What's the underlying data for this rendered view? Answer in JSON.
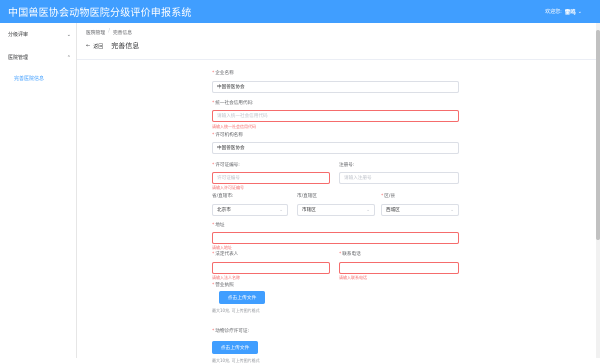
{
  "header": {
    "app_title": "中国兽医协会动物医院分级评价申报系统",
    "welcome_label": "欢迎您:",
    "username": "雷鸣",
    "user_caret": "⌄"
  },
  "sidebar": {
    "menus": [
      {
        "label": "分级评审",
        "chevron": "⌄"
      },
      {
        "label": "医院管理",
        "chevron": "⌃"
      }
    ],
    "sub_item": "完善医院信息"
  },
  "breadcrumb": {
    "item1": "医院管理",
    "sep": "/",
    "item2": "完善信息"
  },
  "page_header": {
    "back_arrow": "←",
    "back_label": "返回",
    "title": "完善信息"
  },
  "form": {
    "required_mark": "*",
    "company_name": {
      "label": "企业名称",
      "value": "中国兽医协会"
    },
    "credit_code": {
      "label": "统一社会信用代码:",
      "placeholder": "请输入统一社会信用代码",
      "error": "请输入统一社会信用代码"
    },
    "license_name": {
      "label": "许可机构名称",
      "value": "中国兽医协会"
    },
    "license_no": {
      "label": "许可证编号:",
      "placeholder": "许可证编号",
      "error": "请输入许可证编号"
    },
    "reg_no": {
      "label": "注册号:",
      "placeholder": "请输入注册号"
    },
    "province": {
      "label": "省/直辖市:",
      "value": "北京市"
    },
    "city": {
      "label": "市/直辖区",
      "value": "市辖区"
    },
    "district": {
      "label": "区/县",
      "value": "西城区"
    },
    "address": {
      "label": "地址",
      "error": "请输入地址"
    },
    "legal_rep": {
      "label": "法定代表人",
      "error": "请输入法人名称"
    },
    "phone": {
      "label": "联系电话",
      "error": "请输入联系电话"
    },
    "business_license": {
      "label": "营业执照",
      "button": "点击上传文件",
      "hint": "最大10兆, 可上传图片格式"
    },
    "medical_license": {
      "label": "动物诊疗许可证:",
      "button": "点击上传文件",
      "hint": "最大10兆, 可上传图片格式"
    },
    "select_caret": "⌄"
  }
}
